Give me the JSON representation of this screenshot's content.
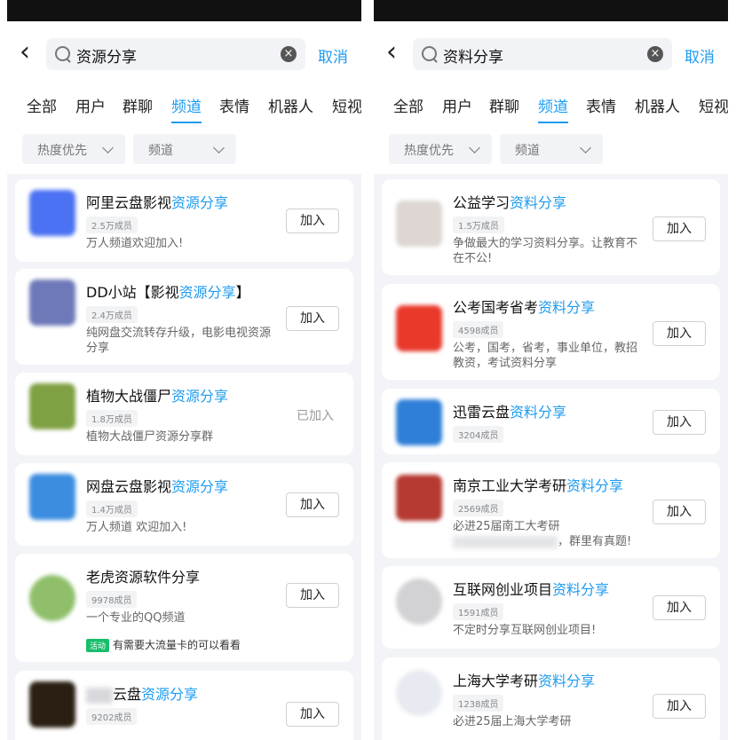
{
  "colors": {
    "accent": "#1d9bf0",
    "joined_text": "#999999",
    "promo_tag": "#19be6b"
  },
  "left": {
    "search": {
      "query": "资源分享",
      "cancel_label": "取消"
    },
    "tabs": [
      "全部",
      "用户",
      "群聊",
      "频道",
      "表情",
      "机器人",
      "短视"
    ],
    "active_tab": "频道",
    "filters": [
      "热度优先",
      "频道"
    ],
    "cards": [
      {
        "title_prefix": "阿里云盘影视",
        "title_highlight": "资源分享",
        "title_suffix": "",
        "members": "2.5万成员",
        "desc": "万人频道欢迎加入!",
        "action": "加入"
      },
      {
        "title_prefix": "DD小站【影视",
        "title_highlight": "资源分享",
        "title_suffix": "】",
        "members": "2.4万成员",
        "desc": "纯网盘交流转存升级，电影电视资源分享",
        "action": "加入"
      },
      {
        "title_prefix": "植物大战僵尸",
        "title_highlight": "资源分享",
        "title_suffix": "",
        "members": "1.8万成员",
        "desc": "植物大战僵尸资源分享群",
        "action": "已加入"
      },
      {
        "title_prefix": "网盘云盘影视",
        "title_highlight": "资源分享",
        "title_suffix": "",
        "members": "1.4万成员",
        "desc": "万人频道 欢迎加入!",
        "action": "加入"
      },
      {
        "title_prefix": "老虎资源软件分享",
        "title_highlight": "",
        "title_suffix": "",
        "members": "9978成员",
        "desc": "一个专业的QQ频道",
        "promo_tag": "活动",
        "promo_text": "有需要大流量卡的可以看看",
        "action": "加入"
      },
      {
        "title_prefix": "云盘",
        "title_highlight": "资源分享",
        "title_suffix": "",
        "members": "9202成员",
        "desc": "",
        "action": "加入"
      }
    ]
  },
  "right": {
    "search": {
      "query": "资料分享",
      "cancel_label": "取消"
    },
    "tabs": [
      "全部",
      "用户",
      "群聊",
      "频道",
      "表情",
      "机器人",
      "短视"
    ],
    "active_tab": "频道",
    "filters": [
      "热度优先",
      "频道"
    ],
    "cards": [
      {
        "title_prefix": "公益学习",
        "title_highlight": "资料分享",
        "members": "1.5万成员",
        "desc": "争做最大的学习资料分享。让教育不在不公!",
        "action": "加入"
      },
      {
        "title_prefix": "公考国考省考",
        "title_highlight": "资料分享",
        "members": "4598成员",
        "desc": "公考，国考，省考，事业单位，教招教资，考试资料分享",
        "action": "加入"
      },
      {
        "title_prefix": "迅雷云盘",
        "title_highlight": "资料分享",
        "members": "3204成员",
        "desc": "",
        "action": "加入"
      },
      {
        "title_prefix": "南京工业大学考研",
        "title_highlight": "资料分享",
        "members": "2569成员",
        "desc": "必进25届南工大考研",
        "desc2": "，群里有真题!",
        "action": "加入"
      },
      {
        "title_prefix": "互联网创业项目",
        "title_highlight": "资料分享",
        "members": "1591成员",
        "desc": "不定时分享互联网创业项目!",
        "action": "加入"
      },
      {
        "title_prefix": "上海大学考研",
        "title_highlight": "资料分享",
        "members": "1238成员",
        "desc": "必进25届上海大学考研",
        "action": "加入"
      }
    ]
  }
}
